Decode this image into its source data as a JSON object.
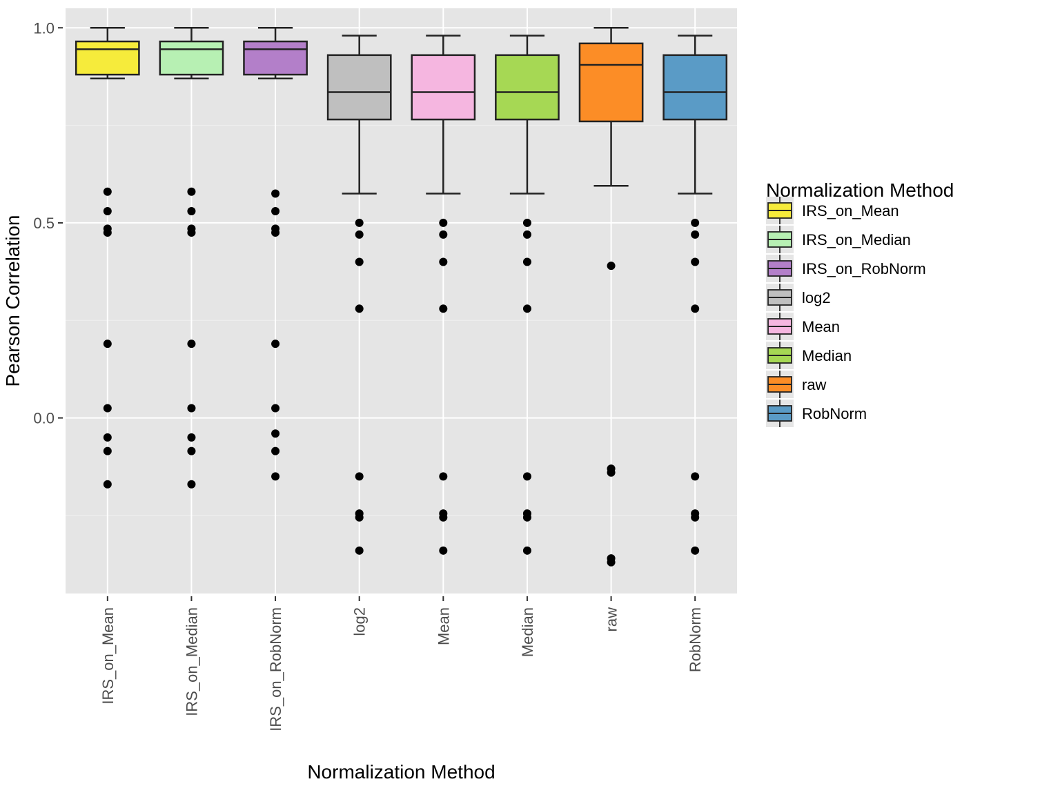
{
  "chart_data": {
    "type": "box",
    "xlabel": "Normalization Method",
    "ylabel": "Pearson Correlation",
    "legend_title": "Normalization Method",
    "ylim": [
      -0.45,
      1.05
    ],
    "y_breaks": [
      0.0,
      0.5,
      1.0
    ],
    "y_minor": [
      -0.25,
      0.25,
      0.75
    ],
    "categories": [
      "IRS_on_Mean",
      "IRS_on_Median",
      "IRS_on_RobNorm",
      "log2",
      "Mean",
      "Median",
      "raw",
      "RobNorm"
    ],
    "colors": {
      "IRS_on_Mean": "#F6EB3B",
      "IRS_on_Median": "#B7F0B3",
      "IRS_on_RobNorm": "#B37FC9",
      "log2": "#BFBFBF",
      "Mean": "#F5B6E0",
      "Median": "#A6D854",
      "raw": "#FC8D26",
      "RobNorm": "#5A9BC6"
    },
    "series": [
      {
        "name": "IRS_on_Mean",
        "lower_whisker": 0.87,
        "q1": 0.88,
        "median": 0.945,
        "q3": 0.965,
        "upper_whisker": 1.0,
        "outliers": [
          0.58,
          0.53,
          0.485,
          0.475,
          0.19,
          0.025,
          -0.05,
          -0.085,
          -0.17
        ]
      },
      {
        "name": "IRS_on_Median",
        "lower_whisker": 0.87,
        "q1": 0.88,
        "median": 0.945,
        "q3": 0.965,
        "upper_whisker": 1.0,
        "outliers": [
          0.58,
          0.53,
          0.485,
          0.475,
          0.19,
          0.025,
          -0.05,
          -0.085,
          -0.17
        ]
      },
      {
        "name": "IRS_on_RobNorm",
        "lower_whisker": 0.87,
        "q1": 0.88,
        "median": 0.945,
        "q3": 0.965,
        "upper_whisker": 1.0,
        "outliers": [
          0.575,
          0.53,
          0.485,
          0.475,
          0.19,
          0.025,
          -0.04,
          -0.085,
          -0.15
        ]
      },
      {
        "name": "log2",
        "lower_whisker": 0.575,
        "q1": 0.765,
        "median": 0.835,
        "q3": 0.93,
        "upper_whisker": 0.98,
        "outliers": [
          0.5,
          0.47,
          0.4,
          0.28,
          -0.15,
          -0.245,
          -0.255,
          -0.34
        ]
      },
      {
        "name": "Mean",
        "lower_whisker": 0.575,
        "q1": 0.765,
        "median": 0.835,
        "q3": 0.93,
        "upper_whisker": 0.98,
        "outliers": [
          0.5,
          0.47,
          0.4,
          0.28,
          -0.15,
          -0.245,
          -0.255,
          -0.34
        ]
      },
      {
        "name": "Median",
        "lower_whisker": 0.575,
        "q1": 0.765,
        "median": 0.835,
        "q3": 0.93,
        "upper_whisker": 0.98,
        "outliers": [
          0.5,
          0.47,
          0.4,
          0.28,
          -0.15,
          -0.245,
          -0.255,
          -0.34
        ]
      },
      {
        "name": "raw",
        "lower_whisker": 0.595,
        "q1": 0.76,
        "median": 0.905,
        "q3": 0.96,
        "upper_whisker": 1.0,
        "outliers": [
          0.39,
          -0.13,
          -0.14,
          -0.36,
          -0.37
        ]
      },
      {
        "name": "RobNorm",
        "lower_whisker": 0.575,
        "q1": 0.765,
        "median": 0.835,
        "q3": 0.93,
        "upper_whisker": 0.98,
        "outliers": [
          0.5,
          0.47,
          0.4,
          0.28,
          -0.15,
          -0.245,
          -0.255,
          -0.34
        ]
      }
    ]
  }
}
